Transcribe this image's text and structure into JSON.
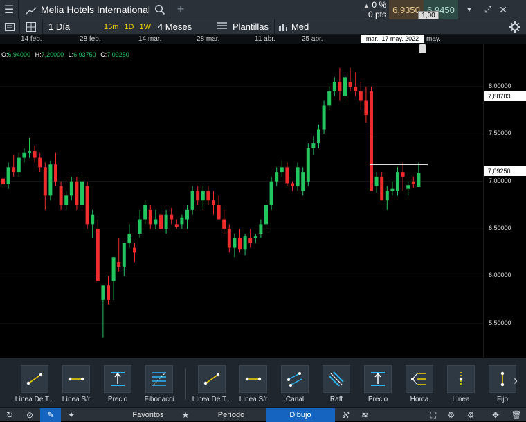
{
  "header": {
    "instrument_title": "Melia Hotels International",
    "change_pct": "0 %",
    "change_pts": "0 pts",
    "bid": "6,9350",
    "ask": "6,9450",
    "spread": "1,00"
  },
  "toolbar": {
    "interval": "1 Día",
    "timeframes": [
      "15m",
      "1D",
      "1W"
    ],
    "range": "4 Meses",
    "templates": "Plantillas",
    "price_type": "Med"
  },
  "date_axis": {
    "labels": [
      "14 feb.",
      "28 feb.",
      "14 mar.",
      "28 mar.",
      "11 abr.",
      "25 abr.",
      "may."
    ],
    "crosshair_label": "mar., 17 may. 2022"
  },
  "ohlc": {
    "o_label": "O:",
    "o": "6,94000",
    "h_label": "H:",
    "h": "7,20000",
    "l_label": "L:",
    "l": "6,93750",
    "c_label": "C:",
    "c": "7,09250"
  },
  "price_axis": {
    "labels": [
      "8,00000",
      "7,50000",
      "7,00000",
      "6,50000",
      "6,00000",
      "5,50000"
    ],
    "crosshair_price": "7,88783",
    "last_price": "7,09250"
  },
  "colors": {
    "up": "#22c55e",
    "down": "#ef2b2b",
    "accent": "#f3d500"
  },
  "chart_data": {
    "type": "candlestick",
    "candles": [
      [
        7.03,
        7.1,
        6.96,
        6.97
      ],
      [
        6.97,
        7.2,
        6.92,
        7.15
      ],
      [
        7.15,
        7.28,
        7.05,
        7.1
      ],
      [
        7.1,
        7.3,
        7.05,
        7.25
      ],
      [
        7.25,
        7.35,
        7.2,
        7.3
      ],
      [
        7.3,
        7.46,
        7.25,
        7.32
      ],
      [
        7.32,
        7.38,
        7.2,
        7.25
      ],
      [
        7.25,
        7.3,
        7.1,
        7.15
      ],
      [
        7.15,
        7.2,
        6.7,
        6.85
      ],
      [
        6.85,
        7.22,
        6.8,
        7.18
      ],
      [
        7.18,
        7.3,
        6.95,
        7.0
      ],
      [
        6.95,
        7.0,
        6.7,
        6.75
      ],
      [
        6.75,
        6.9,
        6.7,
        6.85
      ],
      [
        6.85,
        7.05,
        6.8,
        7.0
      ],
      [
        7.0,
        7.05,
        6.7,
        6.75
      ],
      [
        6.75,
        7.05,
        6.7,
        7.0
      ],
      [
        6.95,
        7.0,
        6.5,
        6.55
      ],
      [
        6.55,
        6.7,
        6.4,
        6.65
      ],
      [
        6.5,
        6.6,
        5.95,
        5.95
      ],
      [
        5.75,
        5.9,
        5.35,
        5.9
      ],
      [
        5.9,
        6.0,
        5.7,
        5.75
      ],
      [
        5.95,
        6.2,
        5.75,
        6.2
      ],
      [
        6.15,
        6.4,
        6.05,
        6.1
      ],
      [
        6.1,
        6.35,
        6.0,
        6.35
      ],
      [
        6.35,
        6.55,
        6.3,
        6.45
      ],
      [
        6.3,
        6.35,
        6.15,
        6.25
      ],
      [
        6.45,
        6.7,
        6.4,
        6.6
      ],
      [
        6.6,
        6.8,
        6.55,
        6.75
      ],
      [
        6.7,
        6.75,
        6.5,
        6.55
      ],
      [
        6.55,
        6.7,
        6.5,
        6.6
      ],
      [
        6.65,
        6.72,
        6.5,
        6.5
      ],
      [
        6.5,
        6.7,
        6.45,
        6.65
      ],
      [
        6.65,
        6.72,
        6.55,
        6.6
      ],
      [
        6.55,
        6.6,
        6.5,
        6.52
      ],
      [
        6.55,
        6.65,
        6.5,
        6.62
      ],
      [
        6.6,
        6.75,
        6.5,
        6.7
      ],
      [
        6.7,
        6.95,
        6.65,
        6.9
      ],
      [
        6.9,
        6.95,
        6.75,
        6.8
      ],
      [
        6.8,
        6.95,
        6.7,
        6.9
      ],
      [
        6.9,
        6.95,
        6.75,
        6.8
      ],
      [
        6.8,
        6.9,
        6.65,
        6.75
      ],
      [
        6.75,
        6.85,
        6.6,
        6.6
      ],
      [
        6.6,
        6.7,
        6.45,
        6.5
      ],
      [
        6.5,
        6.55,
        6.25,
        6.3
      ],
      [
        6.3,
        6.45,
        6.2,
        6.4
      ],
      [
        6.4,
        6.5,
        6.25,
        6.28
      ],
      [
        6.28,
        6.45,
        6.22,
        6.42
      ],
      [
        6.4,
        6.5,
        6.3,
        6.35
      ],
      [
        6.4,
        6.45,
        6.35,
        6.42
      ],
      [
        6.45,
        6.6,
        6.4,
        6.55
      ],
      [
        6.55,
        6.8,
        6.5,
        6.75
      ],
      [
        6.75,
        7.05,
        6.7,
        7.0
      ],
      [
        7.0,
        7.15,
        6.95,
        7.1
      ],
      [
        7.1,
        7.22,
        7.05,
        7.15
      ],
      [
        7.15,
        7.2,
        6.95,
        6.98
      ],
      [
        6.98,
        7.0,
        6.9,
        6.95
      ],
      [
        6.95,
        7.2,
        6.9,
        7.15
      ],
      [
        6.9,
        7.15,
        6.85,
        7.1
      ],
      [
        7.0,
        7.4,
        6.95,
        7.35
      ],
      [
        7.35,
        7.48,
        7.28,
        7.4
      ],
      [
        7.4,
        7.6,
        7.35,
        7.55
      ],
      [
        7.55,
        7.85,
        7.5,
        7.8
      ],
      [
        7.8,
        8.0,
        7.75,
        7.95
      ],
      [
        7.95,
        8.1,
        7.9,
        8.05
      ],
      [
        8.05,
        8.2,
        7.85,
        7.95
      ],
      [
        7.9,
        8.15,
        7.85,
        8.1
      ],
      [
        8.05,
        8.2,
        7.95,
        8.0
      ],
      [
        8.0,
        8.15,
        7.9,
        7.95
      ],
      [
        7.95,
        8.05,
        7.75,
        7.85
      ],
      [
        7.85,
        8.0,
        7.62,
        7.7
      ],
      [
        7.95,
        8.0,
        6.9,
        6.9
      ],
      [
        6.95,
        7.1,
        6.88,
        7.05
      ],
      [
        7.05,
        7.1,
        6.8,
        6.8
      ],
      [
        6.8,
        6.95,
        6.7,
        6.9
      ],
      [
        6.9,
        7.0,
        6.85,
        6.92
      ],
      [
        6.9,
        7.15,
        6.85,
        7.1
      ],
      [
        7.1,
        7.2,
        6.9,
        7.05
      ],
      [
        6.92,
        7.0,
        6.85,
        6.96
      ],
      [
        7.0,
        7.05,
        6.93,
        6.97
      ],
      [
        6.94,
        7.2,
        6.94,
        7.09
      ]
    ],
    "ylim": [
      5.0,
      8.4
    ],
    "hline": 7.18
  },
  "drawing_tools": [
    {
      "label": "Línea De T...",
      "icon": "trend-line-icon"
    },
    {
      "label": "Línea S/r",
      "icon": "support-line-icon"
    },
    {
      "label": "Precio",
      "icon": "price-line-icon"
    },
    {
      "label": "Fibonacci",
      "icon": "fibonacci-icon"
    },
    {
      "label": "Línea De T...",
      "icon": "trend-line-icon"
    },
    {
      "label": "Línea S/r",
      "icon": "support-line-icon"
    },
    {
      "label": "Canal",
      "icon": "channel-icon"
    },
    {
      "label": "Raff",
      "icon": "raff-icon"
    },
    {
      "label": "Precio",
      "icon": "price-line-icon"
    },
    {
      "label": "Horca",
      "icon": "pitchfork-icon"
    },
    {
      "label": "Línea",
      "icon": "vertical-line-icon"
    },
    {
      "label": "Fijo",
      "icon": "fixed-line-icon"
    }
  ],
  "bottom": {
    "tabs": [
      "Favoritos",
      "Período",
      "Dibujo"
    ]
  }
}
